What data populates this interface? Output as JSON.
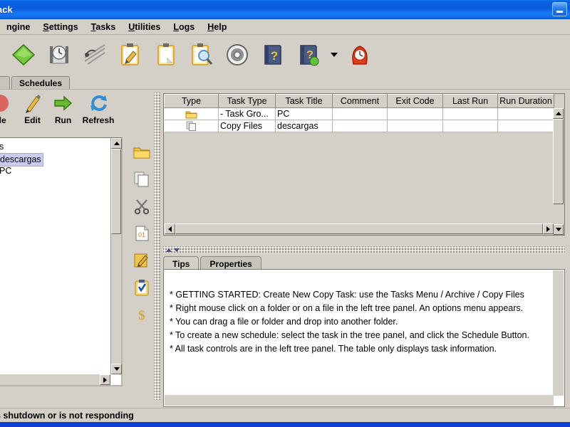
{
  "window": {
    "title": "ack",
    "minimize_label": "minimize"
  },
  "menubar": {
    "items": [
      {
        "label": "ngine",
        "mnemonic": ""
      },
      {
        "label": "Settings",
        "mnemonic": "S"
      },
      {
        "label": "Tasks",
        "mnemonic": "T"
      },
      {
        "label": "Utilities",
        "mnemonic": "U"
      },
      {
        "label": "Logs",
        "mnemonic": "L"
      },
      {
        "label": "Help",
        "mnemonic": "H"
      }
    ]
  },
  "toolbar": {
    "icons": [
      "stop-icon",
      "green-diamond-icon",
      "clock-meter-icon",
      "network-lines-icon",
      "clipboard-edit-icon",
      "clipboard-blank-icon",
      "clipboard-search-icon",
      "disc-icon",
      "help-book-icon",
      "help-book-web-icon",
      "dropdown-arrow-icon",
      "alarm-clock-icon"
    ]
  },
  "tabs": {
    "items": [
      {
        "label": "s",
        "name": "tab-tasks",
        "active": false
      },
      {
        "label": "Schedules",
        "name": "tab-schedules",
        "active": true
      }
    ]
  },
  "left_buttons": {
    "items": [
      {
        "label": "ule",
        "icon": "schedule-icon",
        "name": "schedule-button"
      },
      {
        "label": "Edit",
        "icon": "pencil-icon",
        "name": "edit-button"
      },
      {
        "label": "Run",
        "icon": "green-arrow-icon",
        "name": "run-button"
      },
      {
        "label": "Refresh",
        "icon": "refresh-icon",
        "name": "refresh-button"
      }
    ]
  },
  "tree": {
    "nodes": [
      {
        "label": "s",
        "selected": false
      },
      {
        "label": "descargas",
        "selected": true
      },
      {
        "label": "PC",
        "selected": false
      }
    ]
  },
  "icon_strip": {
    "icons": [
      "folder-icon",
      "copy-icon",
      "scissors-icon",
      "paste-icon",
      "edit-note-icon",
      "checklist-icon",
      "dollar-icon"
    ]
  },
  "table": {
    "columns": [
      "Type",
      "Task Type",
      "Task Title",
      "Comment",
      "Exit Code",
      "Last Run",
      "Run Duration"
    ],
    "rows": [
      {
        "type_icon": "folder-icon",
        "task_type": "- Task Gro...",
        "task_title": "PC",
        "comment": "",
        "exit_code": "",
        "last_run": "",
        "run_duration": ""
      },
      {
        "type_icon": "copy-icon",
        "task_type": "Copy Files",
        "task_title": "descargas",
        "comment": "",
        "exit_code": "",
        "last_run": "",
        "run_duration": ""
      }
    ]
  },
  "tips": {
    "tabs": [
      {
        "label": "Tips",
        "active": true
      },
      {
        "label": "Properties",
        "active": false
      }
    ],
    "lines": [
      "*  GETTING STARTED: Create New Copy Task: use the Tasks Menu / Archive / Copy Files",
      "*  Right mouse click on a folder or on a file in the left tree panel.  An options menu appears.",
      "*  You can drag a file or folder and drop into another folder.",
      "*  To create a new schedule: select the task in the tree panel, and click the Schedule Button.",
      "*  All task controls are in the left tree panel.  The table only displays task information."
    ]
  },
  "statusbar": {
    "text": "s shutdown or is not responding"
  },
  "colors": {
    "titlebar_blue": "#0a63e2",
    "window_face": "#d4d0c8",
    "selection": "#ccccf2",
    "bottom_bar": "#0b3fd4"
  }
}
